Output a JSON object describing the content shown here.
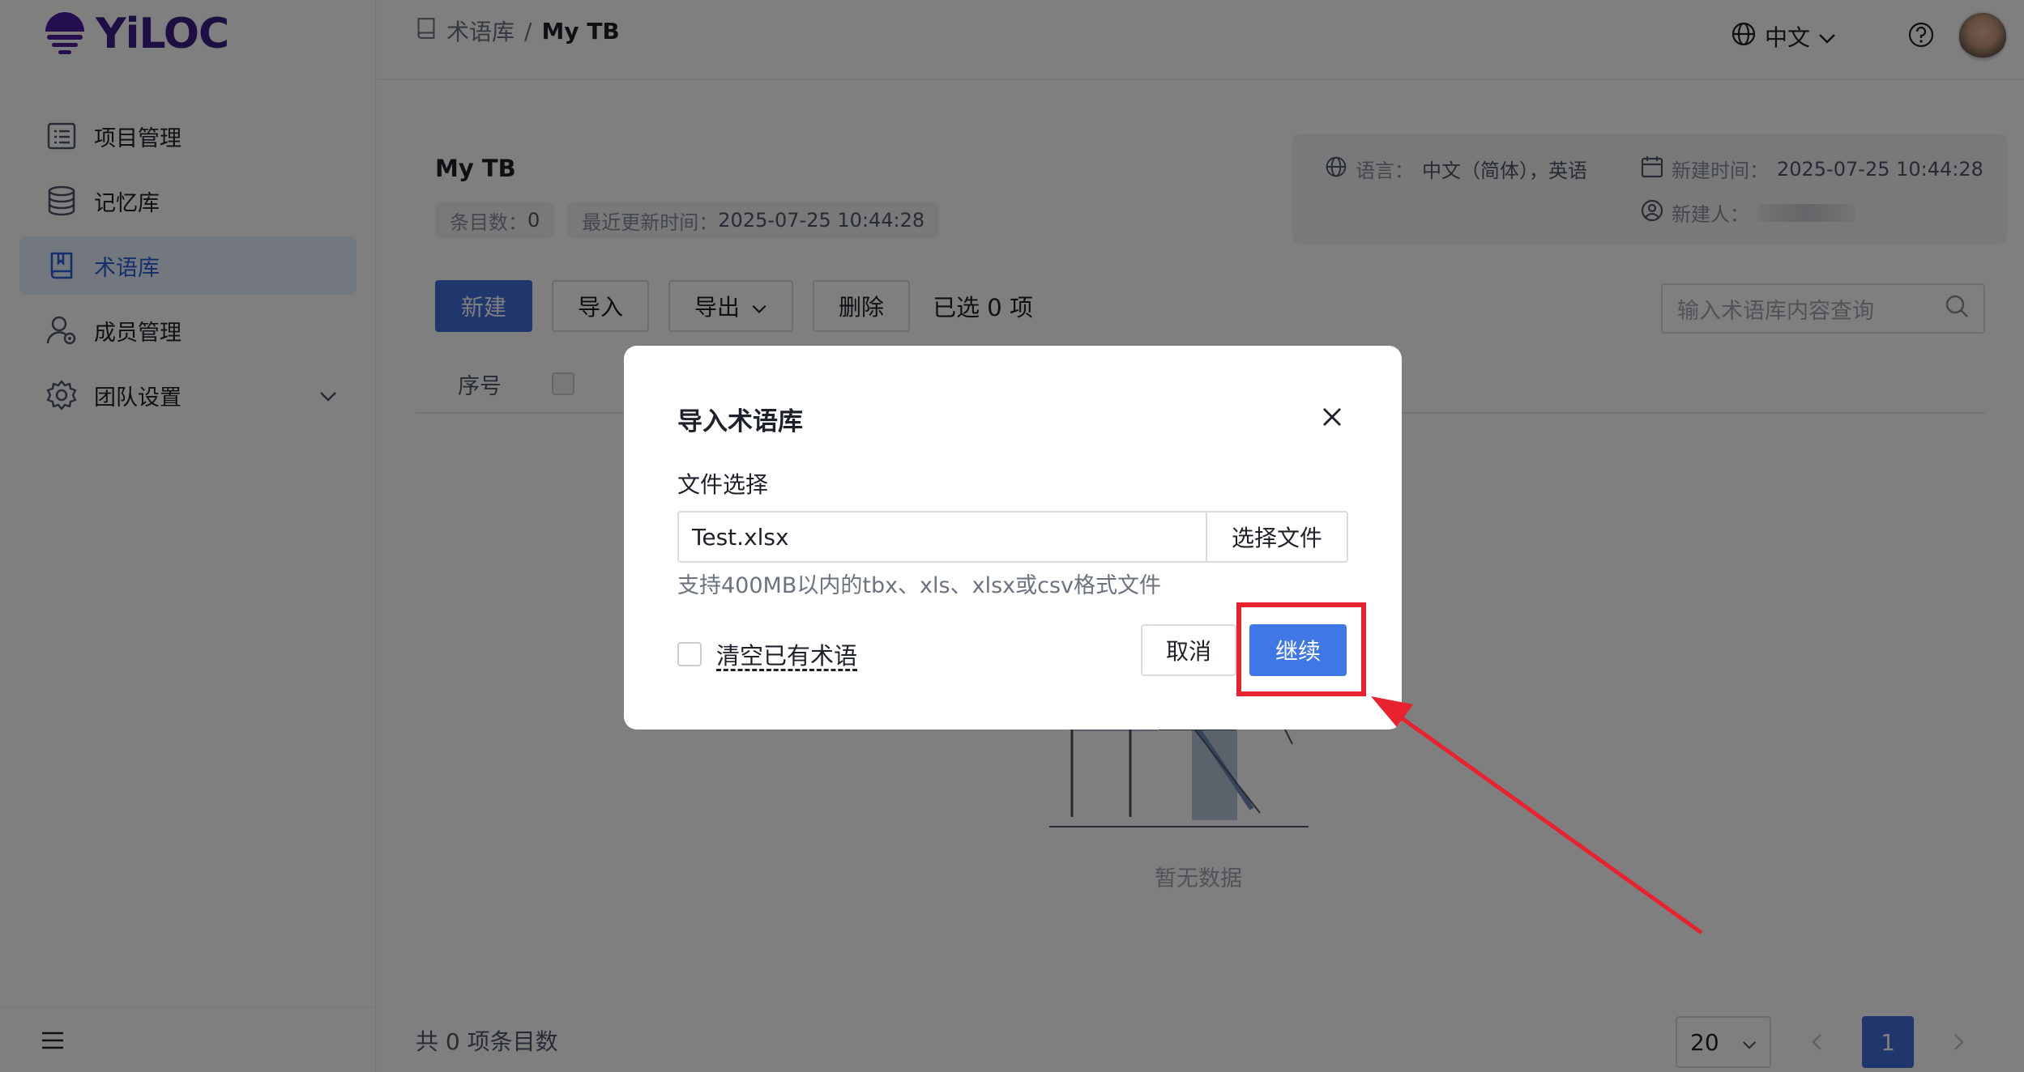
{
  "brand": {
    "name": "YiLOC"
  },
  "sidebar": {
    "items": [
      {
        "label": "项目管理",
        "icon": "list-icon"
      },
      {
        "label": "记忆库",
        "icon": "database-icon"
      },
      {
        "label": "术语库",
        "icon": "book-icon",
        "active": true
      },
      {
        "label": "成员管理",
        "icon": "user-icon"
      },
      {
        "label": "团队设置",
        "icon": "gear-icon"
      }
    ]
  },
  "header": {
    "breadcrumb_root": "术语库",
    "breadcrumb_sep": "/",
    "breadcrumb_current": "My TB",
    "language": "中文"
  },
  "main": {
    "title": "My TB",
    "entry_count_key": "条目数：",
    "entry_count_value": "0",
    "updated_key": "最近更新时间：",
    "updated_value": "2025-07-25 10:44:28",
    "language_key": "语言：",
    "language_value": "中文（简体），英语",
    "created_key": "新建时间：",
    "created_value": "2025-07-25 10:44:28",
    "creator_key": "新建人：",
    "toolbar": {
      "new": "新建",
      "import": "导入",
      "export": "导出",
      "delete": "删除",
      "selected": "已选 0 项"
    },
    "search_placeholder": "输入术语库内容查询",
    "table_col_seq": "序号",
    "empty_text": "暂无数据",
    "total_text": "共 0 项条目数",
    "page_size": "20",
    "current_page": "1"
  },
  "dialog": {
    "title": "导入术语库",
    "file_label": "文件选择",
    "file_value": "Test.xlsx",
    "choose_file": "选择文件",
    "hint": "支持400MB以内的tbx、xls、xlsx或csv格式文件",
    "clear_label": "清空已有术语",
    "cancel": "取消",
    "continue": "继续"
  },
  "colors": {
    "primary": "#3f6fd8",
    "highlight": "#e8222e",
    "brand": "#3b1f86"
  }
}
